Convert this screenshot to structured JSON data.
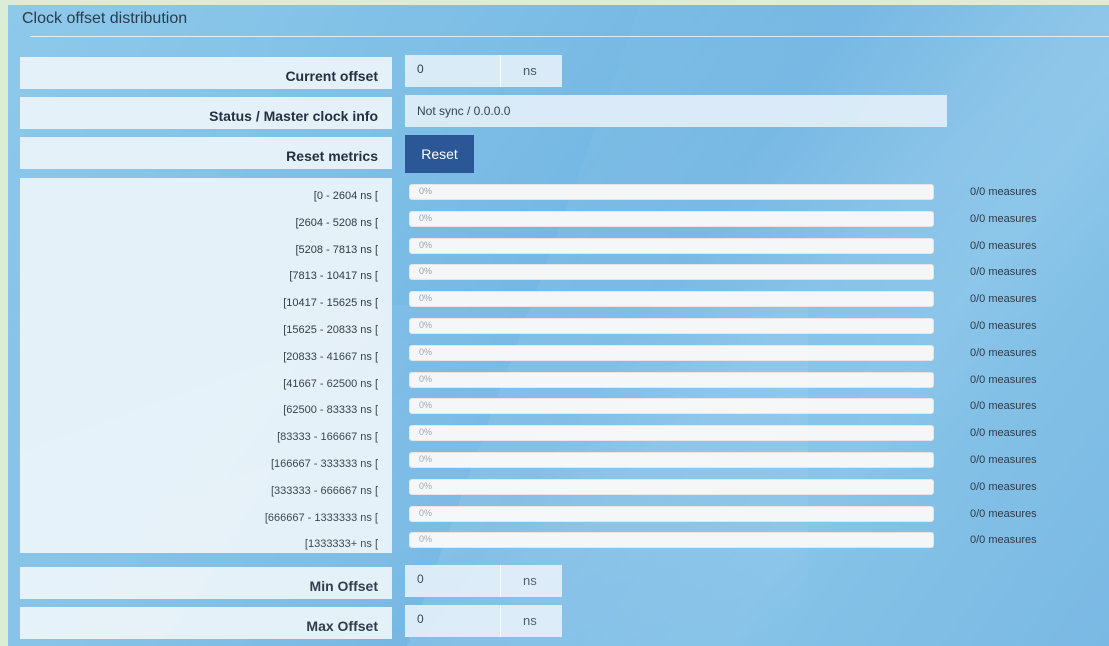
{
  "title": "Clock offset distribution",
  "current_offset": {
    "label": "Current offset",
    "value": "0",
    "unit": "ns"
  },
  "status": {
    "label": "Status / Master clock info",
    "value": "Not sync / 0.0.0.0"
  },
  "reset": {
    "label": "Reset metrics",
    "button": "Reset"
  },
  "distribution": [
    {
      "range": "[0 - 2604 ns [",
      "percent": "0%",
      "fill": 0,
      "measures": "0/0 measures"
    },
    {
      "range": "[2604 - 5208 ns [",
      "percent": "0%",
      "fill": 0,
      "measures": "0/0 measures"
    },
    {
      "range": "[5208 - 7813 ns [",
      "percent": "0%",
      "fill": 0,
      "measures": "0/0 measures"
    },
    {
      "range": "[7813 - 10417 ns [",
      "percent": "0%",
      "fill": 0,
      "measures": "0/0 measures"
    },
    {
      "range": "[10417 - 15625 ns [",
      "percent": "0%",
      "fill": 0,
      "measures": "0/0 measures"
    },
    {
      "range": "[15625 - 20833 ns [",
      "percent": "0%",
      "fill": 0,
      "measures": "0/0 measures"
    },
    {
      "range": "[20833 - 41667 ns [",
      "percent": "0%",
      "fill": 0,
      "measures": "0/0 measures"
    },
    {
      "range": "[41667 - 62500 ns [",
      "percent": "0%",
      "fill": 0,
      "measures": "0/0 measures"
    },
    {
      "range": "[62500 - 83333 ns [",
      "percent": "0%",
      "fill": 0,
      "measures": "0/0 measures"
    },
    {
      "range": "[83333 - 166667 ns [",
      "percent": "0%",
      "fill": 0,
      "measures": "0/0 measures"
    },
    {
      "range": "[166667 - 333333 ns [",
      "percent": "0%",
      "fill": 0,
      "measures": "0/0 measures"
    },
    {
      "range": "[333333 - 666667 ns [",
      "percent": "0%",
      "fill": 0,
      "measures": "0/0 measures"
    },
    {
      "range": "[666667 - 1333333 ns [",
      "percent": "0%",
      "fill": 0,
      "measures": "0/0 measures"
    },
    {
      "range": "[1333333+ ns [",
      "percent": "0%",
      "fill": 0,
      "measures": "0/0 measures"
    }
  ],
  "min_offset": {
    "label": "Min Offset",
    "value": "0",
    "unit": "ns"
  },
  "max_offset": {
    "label": "Max Offset",
    "value": "0",
    "unit": "ns"
  },
  "colors": {
    "accent": "#2b5796",
    "bar_fill": "#337ab7"
  }
}
